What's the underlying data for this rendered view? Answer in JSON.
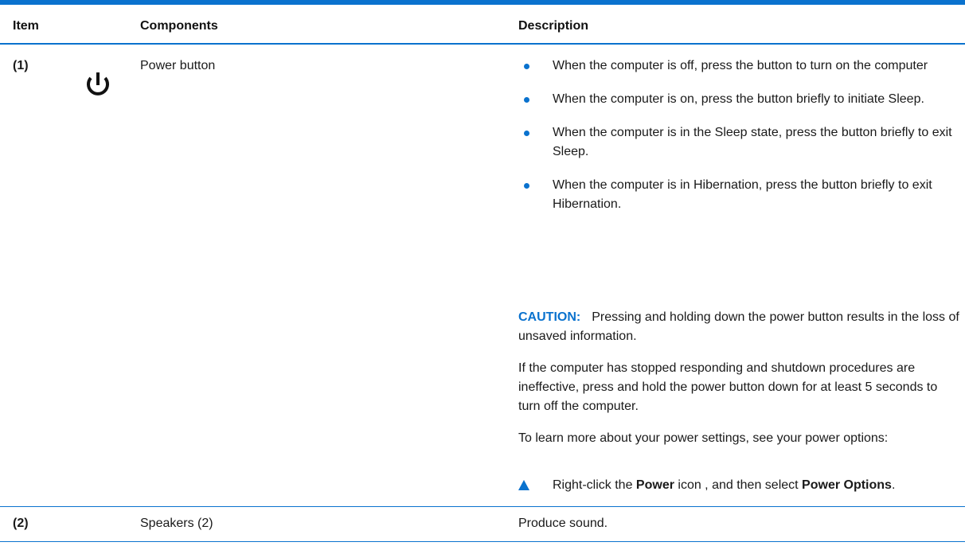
{
  "table": {
    "headers": {
      "item": "Item",
      "components": "Components",
      "description": "Description"
    },
    "rows": [
      {
        "item": "(1)",
        "icon": "power-icon",
        "component": "Power button",
        "bullets": [
          "When the computer is off, press the button to turn on the computer",
          "When the computer is on, press the button briefly to initiate Sleep.",
          "When the computer is in the Sleep state, press the button briefly to exit Sleep.",
          "When the computer is in Hibernation, press the button briefly to exit Hibernation."
        ],
        "caution_label": "CAUTION:",
        "caution_text": "Pressing and holding down the power button results in the loss of unsaved information.",
        "para1": "If the computer has stopped responding and shutdown procedures are ineffective, press and hold the power button down for at least 5 seconds to turn off the computer.",
        "para2": "To learn more about your power settings, see your power options:",
        "step": {
          "prefix": "Right-click the ",
          "bold1": "Power",
          "middle": " icon , and then select ",
          "bold2": "Power Options",
          "suffix": "."
        }
      },
      {
        "item": "(2)",
        "component": "Speakers (2)",
        "description": "Produce sound."
      }
    ]
  },
  "colors": {
    "accent": "#0a72ce",
    "text": "#1a1a1a"
  }
}
